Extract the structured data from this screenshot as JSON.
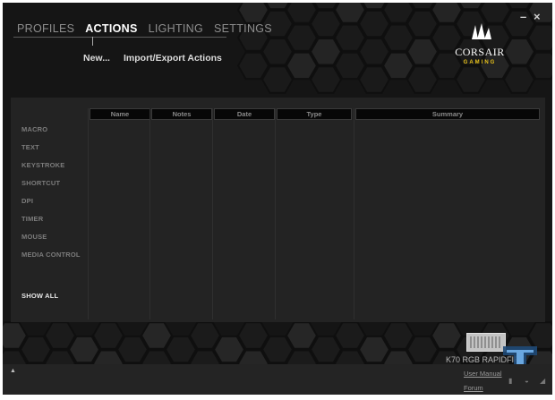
{
  "nav": {
    "tabs": [
      {
        "label": "PROFILES"
      },
      {
        "label": "ACTIONS"
      },
      {
        "label": "LIGHTING"
      },
      {
        "label": "SETTINGS"
      }
    ]
  },
  "window": {
    "minimize": "–",
    "close": "×"
  },
  "brand": {
    "name": "CORSAIR",
    "sub": "GAMING"
  },
  "toolbar": {
    "new_label": "New...",
    "import_export_label": "Import/Export Actions"
  },
  "table": {
    "columns": [
      "Name",
      "Notes",
      "Date",
      "Type",
      "Summary"
    ]
  },
  "categories": [
    {
      "label": "MACRO"
    },
    {
      "label": "TEXT"
    },
    {
      "label": "KEYSTROKE"
    },
    {
      "label": "SHORTCUT"
    },
    {
      "label": "DPI"
    },
    {
      "label": "TIMER"
    },
    {
      "label": "MOUSE"
    },
    {
      "label": "MEDIA CONTROL"
    }
  ],
  "show_all": "SHOW ALL",
  "device": {
    "name": "K70 RGB RAPIDFIRE"
  },
  "links": {
    "user_manual": "User Manual",
    "forum": "Forum"
  },
  "colors": {
    "accent": "#e8c21a",
    "panel": "#232323",
    "background": "#151515"
  }
}
